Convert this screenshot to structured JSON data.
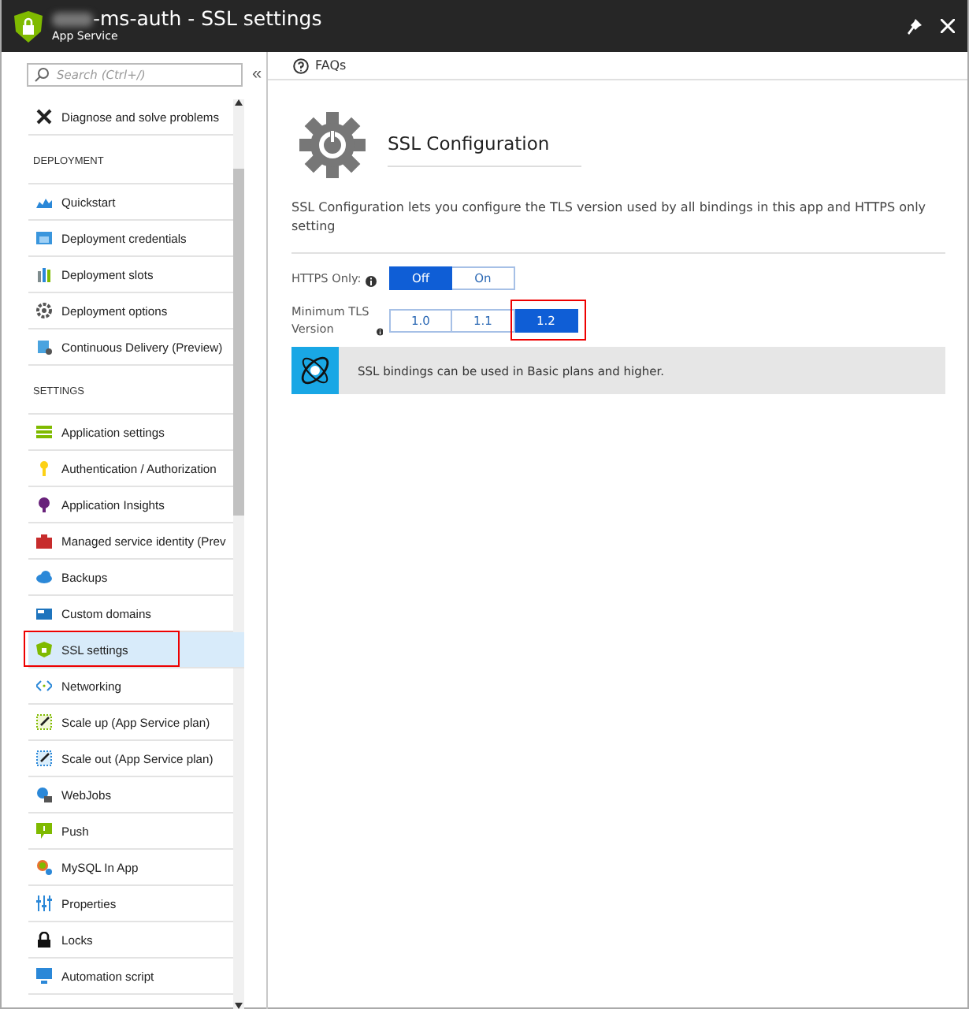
{
  "window": {
    "title": "-ms-auth - SSL settings",
    "subtitle": "App Service"
  },
  "sidebar": {
    "search": {
      "placeholder": "Search (Ctrl+/)"
    },
    "collapse": "«",
    "sections": [
      {
        "items": [
          {
            "label": "Diagnose and solve problems",
            "selected": false,
            "highlighted": false
          }
        ]
      },
      {
        "header": "DEPLOYMENT",
        "items": [
          {
            "label": "Quickstart",
            "selected": false,
            "highlighted": false
          },
          {
            "label": "Deployment credentials",
            "selected": false,
            "highlighted": false
          },
          {
            "label": "Deployment slots",
            "selected": false,
            "highlighted": false
          },
          {
            "label": "Deployment options",
            "selected": false,
            "highlighted": false
          },
          {
            "label": "Continuous Delivery (Preview)",
            "selected": false,
            "highlighted": false
          }
        ]
      },
      {
        "header": "SETTINGS",
        "items": [
          {
            "label": "Application settings",
            "selected": false,
            "highlighted": false
          },
          {
            "label": "Authentication / Authorization",
            "selected": false,
            "highlighted": false
          },
          {
            "label": "Application Insights",
            "selected": false,
            "highlighted": false
          },
          {
            "label": "Managed service identity (Prev",
            "selected": false,
            "highlighted": false
          },
          {
            "label": "Backups",
            "selected": false,
            "highlighted": false
          },
          {
            "label": "Custom domains",
            "selected": false,
            "highlighted": false
          },
          {
            "label": "SSL settings",
            "selected": true,
            "highlighted": true
          },
          {
            "label": "Networking",
            "selected": false,
            "highlighted": false
          },
          {
            "label": "Scale up (App Service plan)",
            "selected": false,
            "highlighted": false
          },
          {
            "label": "Scale out (App Service plan)",
            "selected": false,
            "highlighted": false
          },
          {
            "label": "WebJobs",
            "selected": false,
            "highlighted": false
          },
          {
            "label": "Push",
            "selected": false,
            "highlighted": false
          },
          {
            "label": "MySQL In App",
            "selected": false,
            "highlighted": false
          },
          {
            "label": "Properties",
            "selected": false,
            "highlighted": false
          },
          {
            "label": "Locks",
            "selected": false,
            "highlighted": false
          },
          {
            "label": "Automation script",
            "selected": false,
            "highlighted": false
          }
        ]
      }
    ]
  },
  "toolbar": {
    "faqs": "FAQs"
  },
  "content": {
    "heading": "SSL Configuration",
    "description": "SSL Configuration lets you configure the TLS version used by all bindings in this app and HTTPS only setting",
    "settings": [
      {
        "label": "HTTPS Only:",
        "options": [
          {
            "label": "Off",
            "selected": true,
            "highlighted": false
          },
          {
            "label": "On",
            "selected": false,
            "highlighted": false
          }
        ]
      },
      {
        "label": "Minimum TLS Version",
        "options": [
          {
            "label": "1.0",
            "selected": false,
            "highlighted": false
          },
          {
            "label": "1.1",
            "selected": false,
            "highlighted": false
          },
          {
            "label": "1.2",
            "selected": true,
            "highlighted": true
          }
        ]
      }
    ],
    "banner": "SSL bindings can be used in Basic plans and higher."
  }
}
